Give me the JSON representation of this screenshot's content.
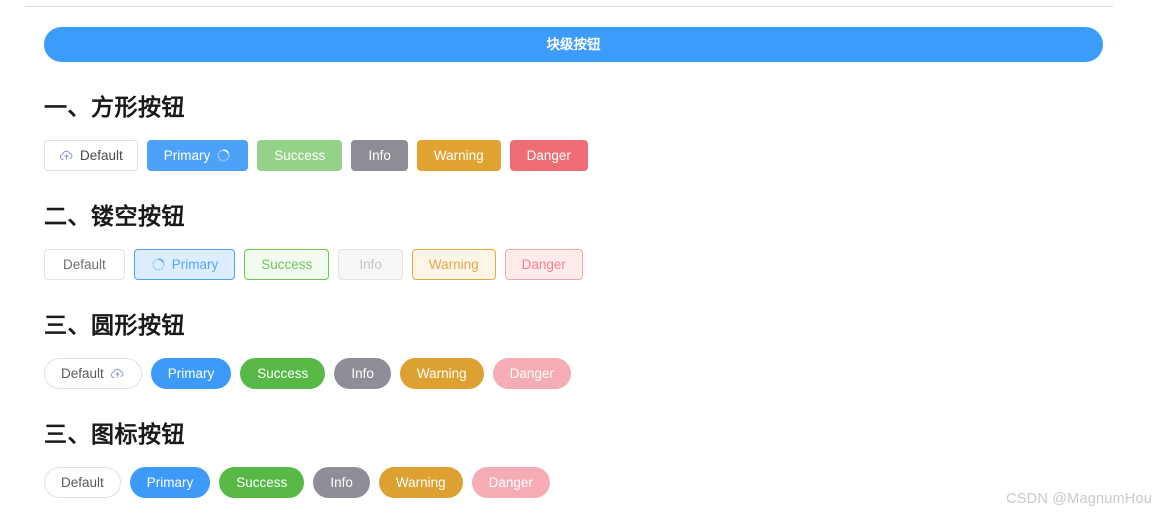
{
  "block_button": {
    "label": "块级按钮",
    "color": "#3c9cfb"
  },
  "watermark": "CSDN @MagnumHou",
  "sections": [
    {
      "heading": "一、方形按钮",
      "buttons": [
        {
          "label": "Default",
          "icon_before": "cloud-upload-icon",
          "color": "#ffffff"
        },
        {
          "label": "Primary",
          "icon_after": "loading-spinner-icon",
          "color": "#4ca2f8"
        },
        {
          "label": "Success",
          "color": "#93d288"
        },
        {
          "label": "Info",
          "color": "#8d8d95"
        },
        {
          "label": "Warning",
          "color": "#e0a231"
        },
        {
          "label": "Danger",
          "color": "#f16d76"
        }
      ]
    },
    {
      "heading": "二、镂空按钮",
      "buttons": [
        {
          "label": "Default",
          "color": "#ffffff"
        },
        {
          "label": "Primary",
          "icon_before": "loading-spinner-icon",
          "color": "#4ca2f8"
        },
        {
          "label": "Success",
          "color": "#6cc551"
        },
        {
          "label": "Info",
          "color": "#c3c5c7"
        },
        {
          "label": "Warning",
          "color": "#e5a93c"
        },
        {
          "label": "Danger",
          "color": "#f4a8af"
        }
      ]
    },
    {
      "heading": "三、圆形按钮",
      "buttons": [
        {
          "label": "Default",
          "icon_after": "cloud-upload-icon",
          "color": "#ffffff"
        },
        {
          "label": "Primary",
          "color": "#3d9bf7"
        },
        {
          "label": "Success",
          "color": "#57b846"
        },
        {
          "label": "Info",
          "color": "#8e8e96"
        },
        {
          "label": "Warning",
          "color": "#dca130"
        },
        {
          "label": "Danger",
          "color": "#f5acb4"
        }
      ]
    },
    {
      "heading": "三、图标按钮",
      "buttons": [
        {
          "label": "Default",
          "color": "#ffffff"
        },
        {
          "label": "Primary",
          "color": "#3d9bf7"
        },
        {
          "label": "Success",
          "color": "#57b846"
        },
        {
          "label": "Info",
          "color": "#8e8e96"
        },
        {
          "label": "Warning",
          "color": "#dca130"
        },
        {
          "label": "Danger",
          "color": "#f5acb4"
        }
      ]
    }
  ]
}
